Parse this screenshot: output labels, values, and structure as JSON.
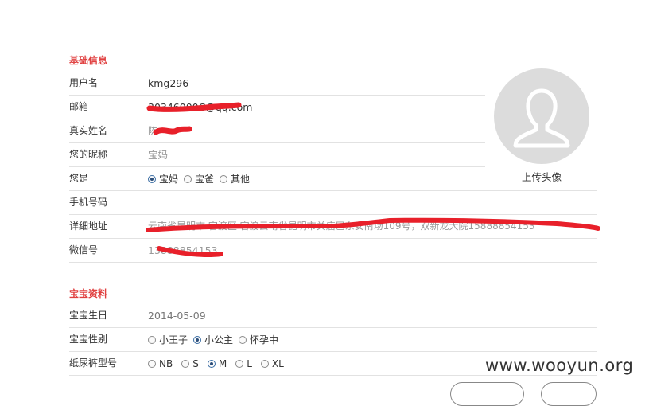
{
  "basic": {
    "section_title": "基础信息",
    "username": {
      "label": "用户名",
      "value": "kmg296"
    },
    "email": {
      "label": "邮箱",
      "value": "30346000C@qq.com"
    },
    "realname": {
      "label": "真实姓名",
      "value": "陈"
    },
    "nickname": {
      "label": "您的昵称",
      "value": "宝妈"
    },
    "role": {
      "label": "您是",
      "options": [
        "宝妈",
        "宝爸",
        "其他"
      ],
      "selected": "宝妈"
    },
    "phone": {
      "label": "手机号码",
      "value": ""
    },
    "address": {
      "label": "详细地址",
      "value": "云南省昆明市 官渡区 官渡云南省昆明市关庙巴东安南场109号，双新龙大院15888854153"
    },
    "wechat": {
      "label": "微信号",
      "value": "13888854153"
    }
  },
  "avatar": {
    "upload_label": "上传头像",
    "icon": "user-silhouette-icon"
  },
  "baby": {
    "section_title": "宝宝资料",
    "birthday": {
      "label": "宝宝生日",
      "value": "2014-05-09"
    },
    "gender": {
      "label": "宝宝性别",
      "options": [
        "小王子",
        "小公主",
        "怀孕中"
      ],
      "selected": "小公主"
    },
    "diaper": {
      "label": "纸尿裤型号",
      "options": [
        "NB",
        "S",
        "M",
        "L",
        "XL"
      ],
      "selected": "M"
    }
  },
  "watermark": "www.wooyun.org",
  "colors": {
    "accent": "#e04040",
    "redaction": "#e8202a",
    "avatar_bg": "#dcdcdc"
  }
}
